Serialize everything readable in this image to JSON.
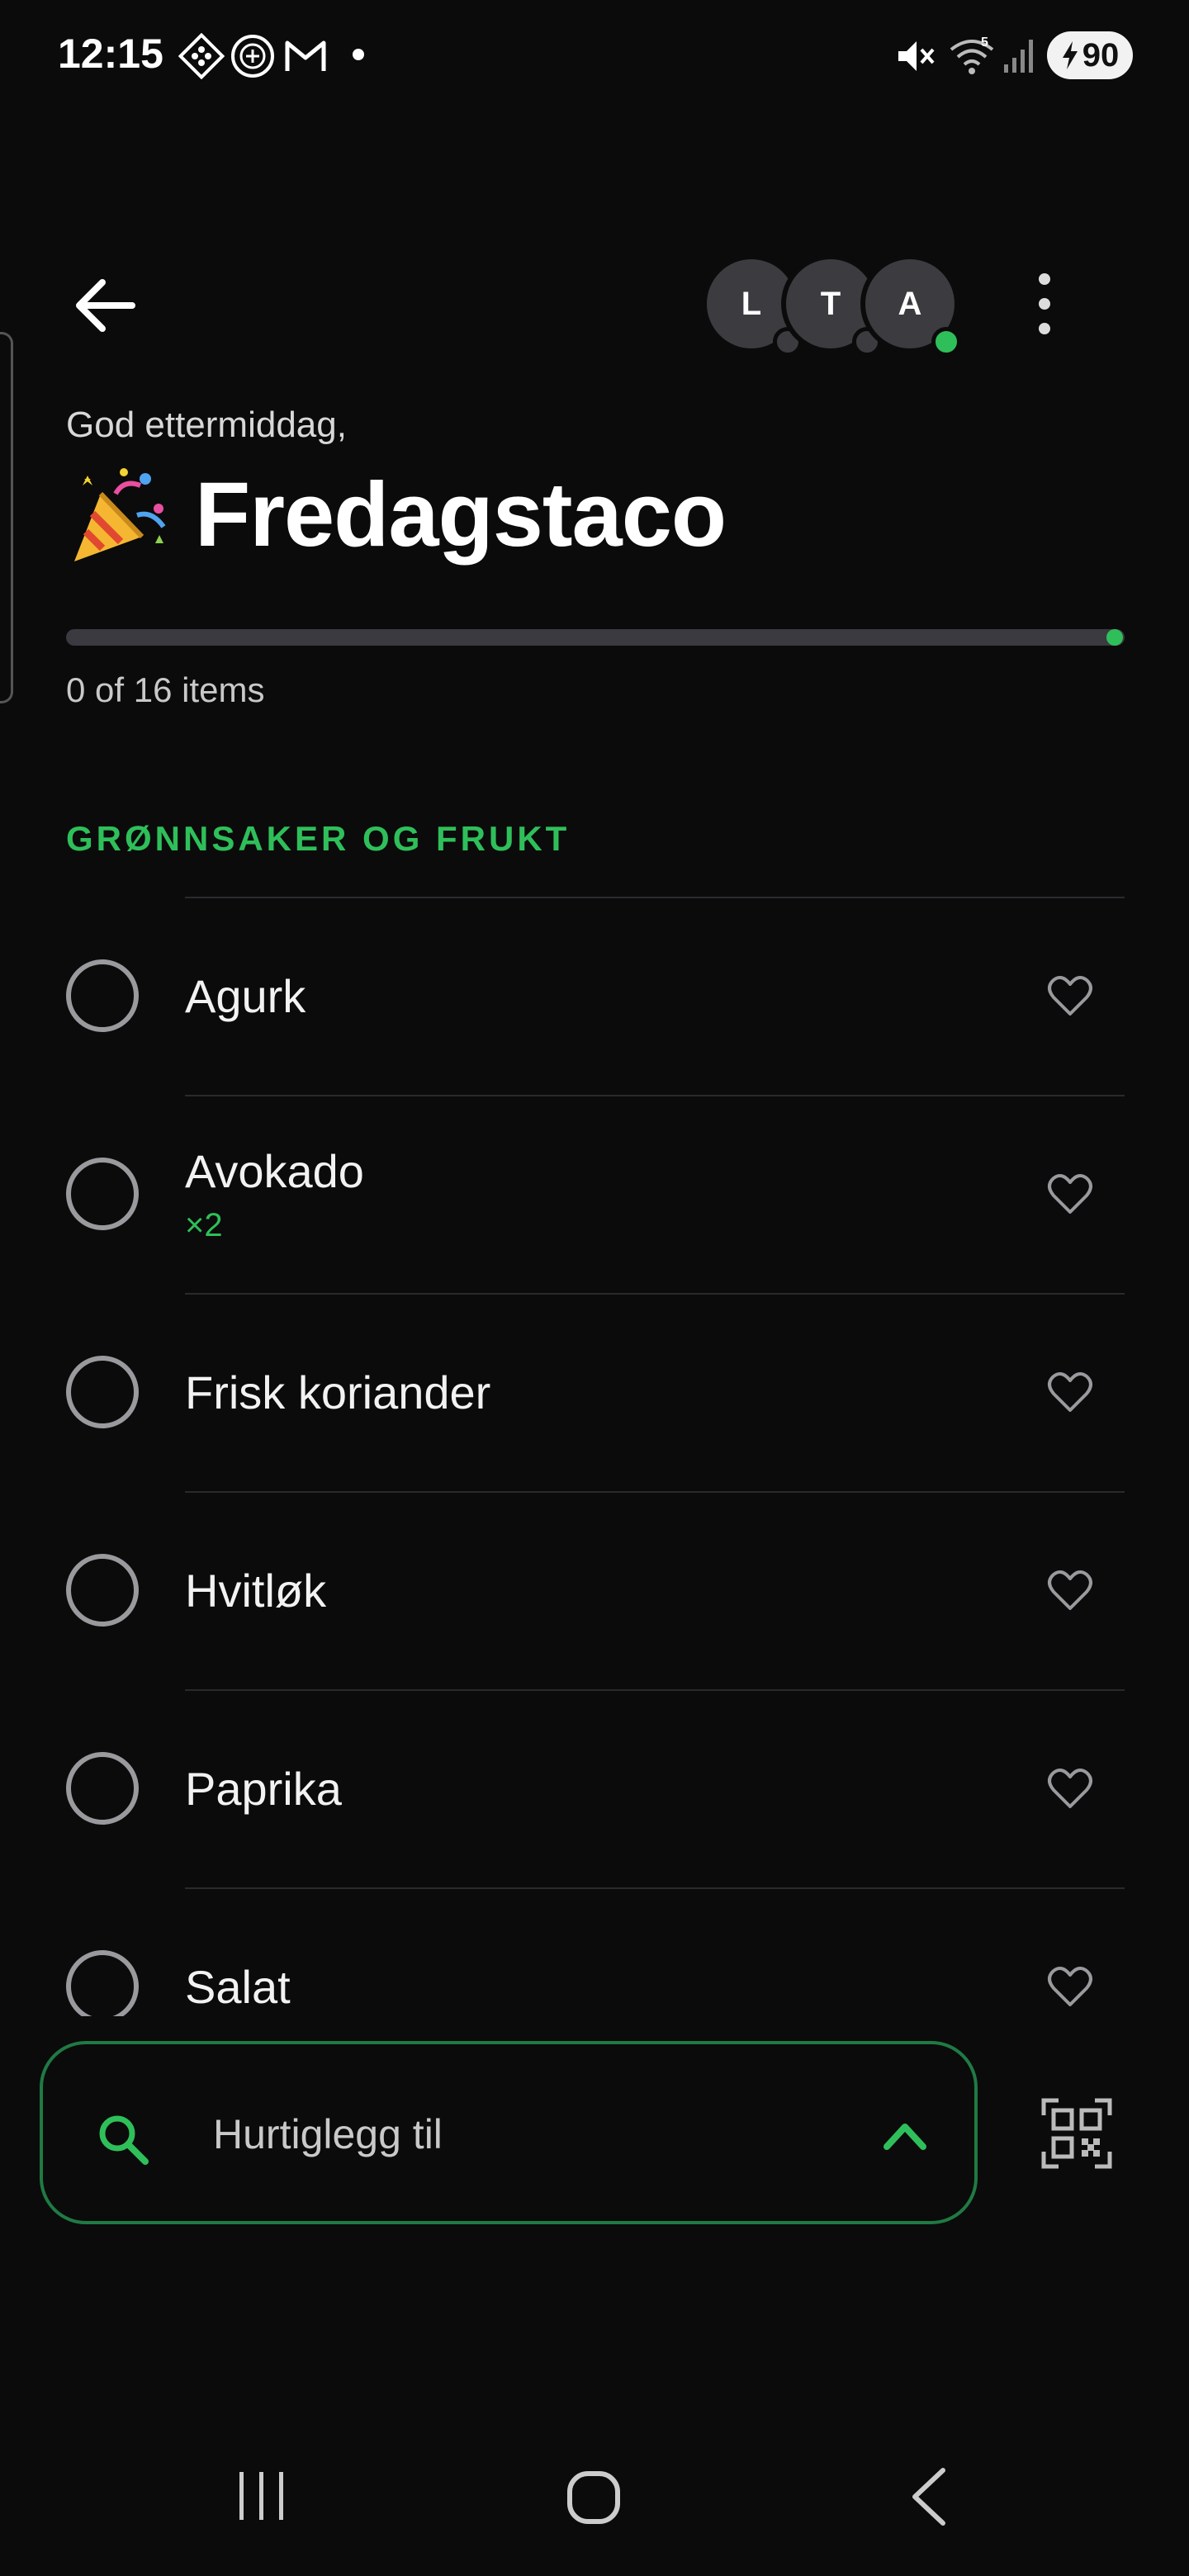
{
  "status_bar": {
    "time": "12:15",
    "battery": "90",
    "icons": [
      "widget-icon",
      "club-crest-icon",
      "gmail-icon",
      "notification-dot",
      "mute-icon",
      "wifi-icon",
      "signal-icon",
      "battery-charging-icon"
    ]
  },
  "header": {
    "avatars": [
      {
        "initial": "L",
        "online": false
      },
      {
        "initial": "T",
        "online": false
      },
      {
        "initial": "A",
        "online": true
      }
    ]
  },
  "list": {
    "greeting": "God ettermiddag,",
    "emoji_icon": "party-popper-icon",
    "title": "Fredagstaco",
    "progress_fraction": 0,
    "progress_text": "0 of 16 items"
  },
  "section": {
    "title": "GRØNNSAKER OG FRUKT",
    "items": [
      {
        "name": "Agurk",
        "qty": ""
      },
      {
        "name": "Avokado",
        "qty": "×2"
      },
      {
        "name": "Frisk koriander",
        "qty": ""
      },
      {
        "name": "Hvitløk",
        "qty": ""
      },
      {
        "name": "Paprika",
        "qty": ""
      },
      {
        "name": "Salat",
        "qty": ""
      }
    ]
  },
  "quick_add": {
    "placeholder": "Hurtiglegg til"
  },
  "colors": {
    "accent": "#2fbf5a",
    "background": "#0b0b0b",
    "avatar": "#3c3b40"
  }
}
